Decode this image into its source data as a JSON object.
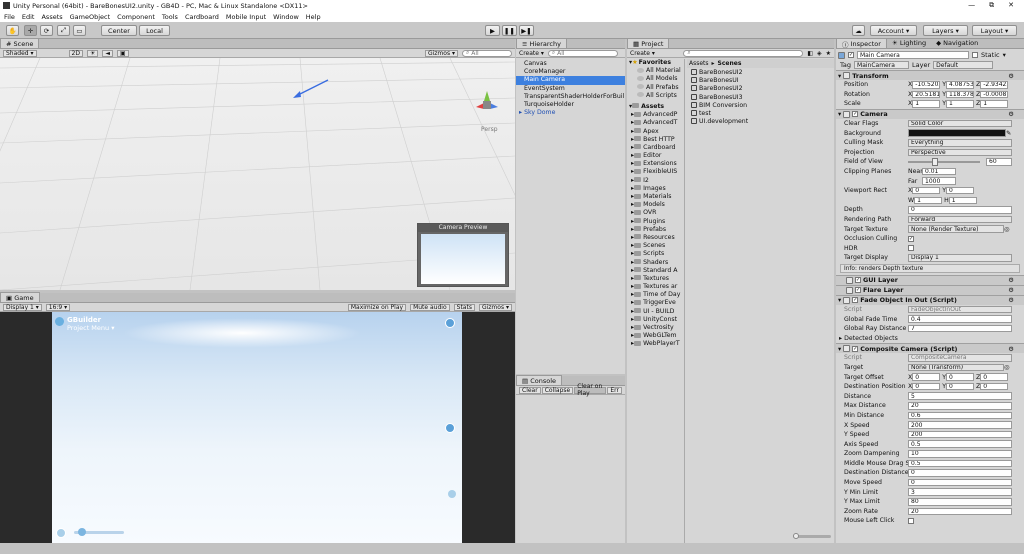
{
  "window": {
    "title": "Unity Personal (64bit) - BareBonesUI2.unity - GB4D - PC, Mac & Linux Standalone <DX11>",
    "min": "—",
    "max": "⧉",
    "close": "✕"
  },
  "menu": [
    "File",
    "Edit",
    "Assets",
    "GameObject",
    "Component",
    "Tools",
    "Cardboard",
    "Mobile Input",
    "Window",
    "Help"
  ],
  "toolbar": {
    "pivot": "Center",
    "space": "Local",
    "account": "Account",
    "layers": "Layers",
    "layout": "Layout"
  },
  "scene": {
    "tab": "Scene",
    "shading": "Shaded",
    "mode2d": "2D",
    "gizmos": "Gizmos",
    "search": "All",
    "persp": "Persp",
    "camera_preview": "Camera Preview"
  },
  "game": {
    "tab": "Game",
    "display": "Display 1",
    "aspect": "16:9",
    "maximize": "Maximize on Play",
    "mute": "Mute audio",
    "stats": "Stats",
    "gizmos": "Gizmos",
    "brand": "GBuilder",
    "menu": "Project Menu"
  },
  "hierarchy": {
    "tab": "Hierarchy",
    "create": "Create",
    "search": "All",
    "items": [
      {
        "label": "Canvas",
        "selected": false
      },
      {
        "label": "CoreManager",
        "selected": false
      },
      {
        "label": "Main Camera",
        "selected": true
      },
      {
        "label": "EventSystem",
        "selected": false
      },
      {
        "label": "TransparentShaderHolderForBuil",
        "selected": false
      },
      {
        "label": "TurquoiseHolder",
        "selected": false
      },
      {
        "label": "Sky Dome",
        "selected": false
      }
    ]
  },
  "console": {
    "tab": "Console",
    "clear": "Clear",
    "collapse": "Collapse",
    "clear_on_play": "Clear on Play",
    "error_pause": "Err"
  },
  "project": {
    "tab": "Project",
    "create": "Create",
    "favorites_label": "Favorites",
    "favorites": [
      "All Material",
      "All Models",
      "All Prefabs",
      "All Scripts"
    ],
    "assets_label": "Assets",
    "folders": [
      "AdvancedP",
      "AdvancedT",
      "Apex",
      "Best HTTP",
      "Cardboard",
      "Editor",
      "Extensions",
      "FlexibleUIS",
      "I2",
      "Images",
      "Materials",
      "Models",
      "OVR",
      "Plugins",
      "Prefabs",
      "Resources",
      "Scenes",
      "Scripts",
      "Shaders",
      "Standard A",
      "Textures",
      "Textures ar",
      "Time of Day",
      "TriggerEve",
      "UI - BUILD",
      "UnityConst",
      "Vectrosity",
      "WebGLTem",
      "WebPlayerT"
    ],
    "breadcrumb": [
      "Assets",
      "Scenes"
    ],
    "files": [
      "BareBonesUI2",
      "BareBonesUI",
      "BareBonesUI2",
      "BareBonesUI3",
      "BIM Conversion",
      "test",
      "UI.development"
    ]
  },
  "inspector": {
    "tabs": [
      "Inspector",
      "Lighting",
      "Navigation"
    ],
    "name": "Main Camera",
    "static": "Static",
    "tag_label": "Tag",
    "tag": "MainCamera",
    "layer_label": "Layer",
    "layer": "Default",
    "transform": {
      "title": "Transform",
      "position": {
        "label": "Position",
        "x": "-10.5205",
        "y": "4.087535",
        "z": "-2.93425"
      },
      "rotation": {
        "label": "Rotation",
        "x": "20.5181",
        "y": "118.378",
        "z": "-0.0008"
      },
      "scale": {
        "label": "Scale",
        "x": "1",
        "y": "1",
        "z": "1"
      }
    },
    "camera": {
      "title": "Camera",
      "rows": [
        {
          "label": "Clear Flags",
          "value": "Solid Color"
        },
        {
          "label": "Background",
          "value": ""
        },
        {
          "label": "Culling Mask",
          "value": "Everything"
        },
        {
          "label": "Projection",
          "value": "Perspective"
        },
        {
          "label": "Field of View",
          "value": "60"
        },
        {
          "label": "Clipping Planes",
          "near_label": "Near",
          "near": "0.01",
          "far_label": "Far",
          "far": "1000"
        },
        {
          "label": "Viewport Rect",
          "x": "0",
          "y": "0",
          "w": "1",
          "h": "1"
        },
        {
          "label": "Depth",
          "value": "0"
        },
        {
          "label": "Rendering Path",
          "value": "Forward"
        },
        {
          "label": "Target Texture",
          "value": "None (Render Texture)"
        },
        {
          "label": "Occlusion Culling",
          "value": "✓"
        },
        {
          "label": "HDR",
          "value": ""
        },
        {
          "label": "Target Display",
          "value": "Display 1"
        }
      ],
      "info": "Info: renders Depth texture"
    },
    "gui_layer": "GUI Layer",
    "flare_layer": "Flare Layer",
    "fade": {
      "title": "Fade Object In Out (Script)",
      "script_label": "Script",
      "script": "FadeObjectInOut",
      "rows": [
        {
          "label": "Global Fade Time",
          "value": "0.4"
        },
        {
          "label": "Global Ray Distance",
          "value": "7"
        }
      ],
      "detected": "Detected Objects"
    },
    "composite": {
      "title": "Composite Camera (Script)",
      "script_label": "Script",
      "script": "CompositeCamera",
      "target_label": "Target",
      "target": "None (Transform)",
      "offset": {
        "label": "Target Offset",
        "x": "0",
        "y": "0",
        "z": "0"
      },
      "dest": {
        "label": "Destination Position",
        "x": "0",
        "y": "0",
        "z": "0"
      },
      "rows": [
        {
          "label": "Distance",
          "value": "5"
        },
        {
          "label": "Max Distance",
          "value": "20"
        },
        {
          "label": "Min Distance",
          "value": "0.6"
        },
        {
          "label": "X Speed",
          "value": "200"
        },
        {
          "label": "Y Speed",
          "value": "200"
        },
        {
          "label": "Axis Speed",
          "value": "0.5"
        },
        {
          "label": "Zoom Dampening",
          "value": "10"
        },
        {
          "label": "Middle Mouse Drag S",
          "value": "0.5"
        },
        {
          "label": "Destination Distance",
          "value": "0"
        },
        {
          "label": "Move Speed",
          "value": "0"
        },
        {
          "label": "Y Min Limit",
          "value": "3"
        },
        {
          "label": "Y Max Limit",
          "value": "80"
        },
        {
          "label": "Zoom Rate",
          "value": "20"
        },
        {
          "label": "Mouse Left Click",
          "value": ""
        }
      ]
    }
  }
}
